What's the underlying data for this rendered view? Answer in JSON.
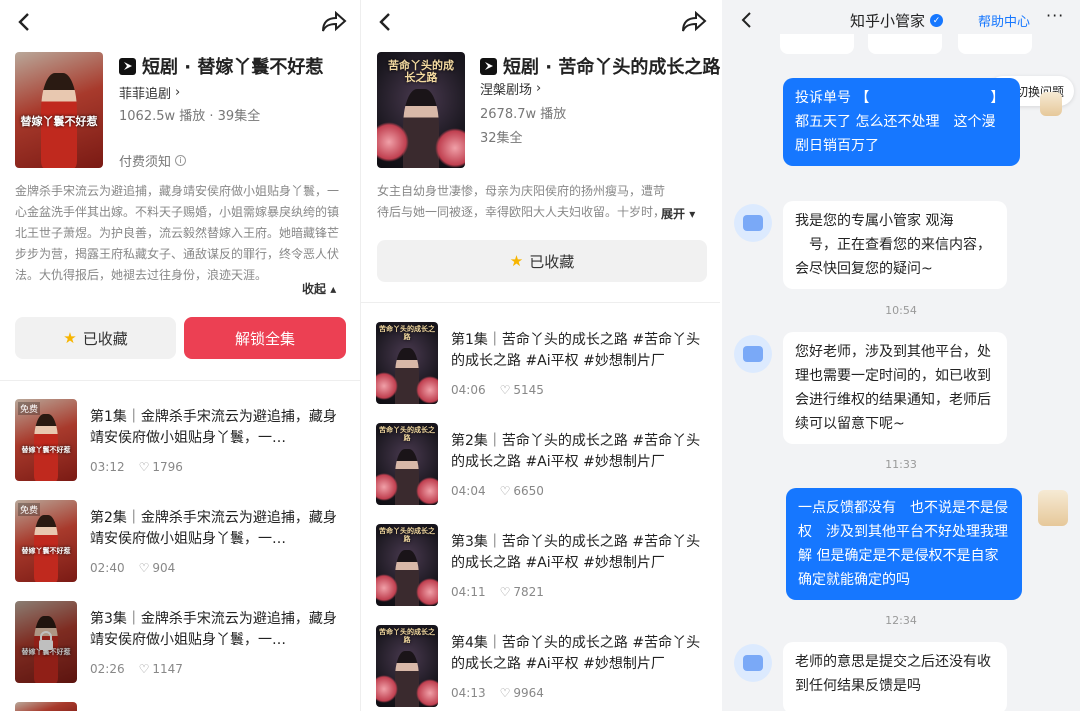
{
  "left": {
    "cover_text": "替嫁丫鬟不好惹",
    "title": "短剧 · 替嫁丫鬟不好惹",
    "author": "菲菲追剧",
    "stats": "1062.5w 播放 · 39集全",
    "pay_notice": "付费须知",
    "description": "金牌杀手宋流云为避追捕，藏身靖安侯府做小姐贴身丫鬟，一心金盆洗手伴其出嫁。不料天子赐婚，小姐需嫁暴戾纨绔的镇北王世子萧煜。为护良善，流云毅然替嫁入王府。她暗藏锋芒步步为营，揭露王府私藏女子、通敌谋反的罪行，终令恶人伏法。大仇得报后，她褪去过往身份，浪迹天涯。",
    "collapse": "收起",
    "fav_label": "已收藏",
    "unlock_label": "解锁全集",
    "free_badge": "免费",
    "episodes": [
      {
        "title": "第1集｜金牌杀手宋流云为避追捕，藏身靖安侯府做小姐贴身丫鬟，一…",
        "time": "03:12",
        "likes": "1796"
      },
      {
        "title": "第2集｜金牌杀手宋流云为避追捕，藏身靖安侯府做小姐贴身丫鬟，一…",
        "time": "02:40",
        "likes": "904"
      },
      {
        "title": "第3集｜金牌杀手宋流云为避追捕，藏身靖安侯府做小姐贴身丫鬟，一…",
        "time": "02:26",
        "likes": "1147"
      }
    ]
  },
  "middle": {
    "cover_text": "苦命丫头的成长之路",
    "title": "短剧 · 苦命丫头的成长之路",
    "author": "涅槃剧场",
    "plays": "2678.7w 播放",
    "count": "32集全",
    "description": "女主自幼身世凄惨，母亲为庆阳侯府的扬州瘦马，遭苛待后与她一同被逐，幸得欧阳大人夫妇收留。十岁时，",
    "expand": "展开",
    "fav_label": "已收藏",
    "episodes": [
      {
        "title": "第1集｜苦命丫头的成长之路 #苦命丫头的成长之路 #Ai平权 #妙想制片厂",
        "time": "04:06",
        "likes": "5145"
      },
      {
        "title": "第2集｜苦命丫头的成长之路 #苦命丫头的成长之路 #Ai平权 #妙想制片厂",
        "time": "04:04",
        "likes": "6650"
      },
      {
        "title": "第3集｜苦命丫头的成长之路 #苦命丫头的成长之路 #Ai平权 #妙想制片厂",
        "time": "04:11",
        "likes": "7821"
      },
      {
        "title": "第4集｜苦命丫头的成长之路 #苦命丫头的成长之路 #Ai平权 #妙想制片厂",
        "time": "04:13",
        "likes": "9964"
      }
    ]
  },
  "chat": {
    "title": "知乎小管家",
    "help": "帮助中心",
    "switch": "切换问题",
    "messages": {
      "m1": "投诉单号 【 　　　　　　　　 】 都五天了 怎么还不处理　这个漫剧日销百万了",
      "m2": "我是您的专属小管家 观海 　号，正在查看您的来信内容，会尽快回复您的疑问~",
      "m3": "您好老师，涉及到其他平台，处理也需要一定时间的，如已收到会进行维权的结果通知，老师后续可以留意下呢~",
      "m4": "一点反馈都没有　也不说是不是侵权　涉及到其他平台不好处理我理解 但是确定是不是侵权不是自家确定就能确定的吗",
      "m5": "老师的意思是提交之后还没有收到任何结果反馈是吗"
    },
    "times": {
      "t1": "10:54",
      "t2": "11:33",
      "t3": "12:34"
    }
  },
  "colors": {
    "accent_red": "#ec4053",
    "chat_blue": "#1677ff"
  }
}
